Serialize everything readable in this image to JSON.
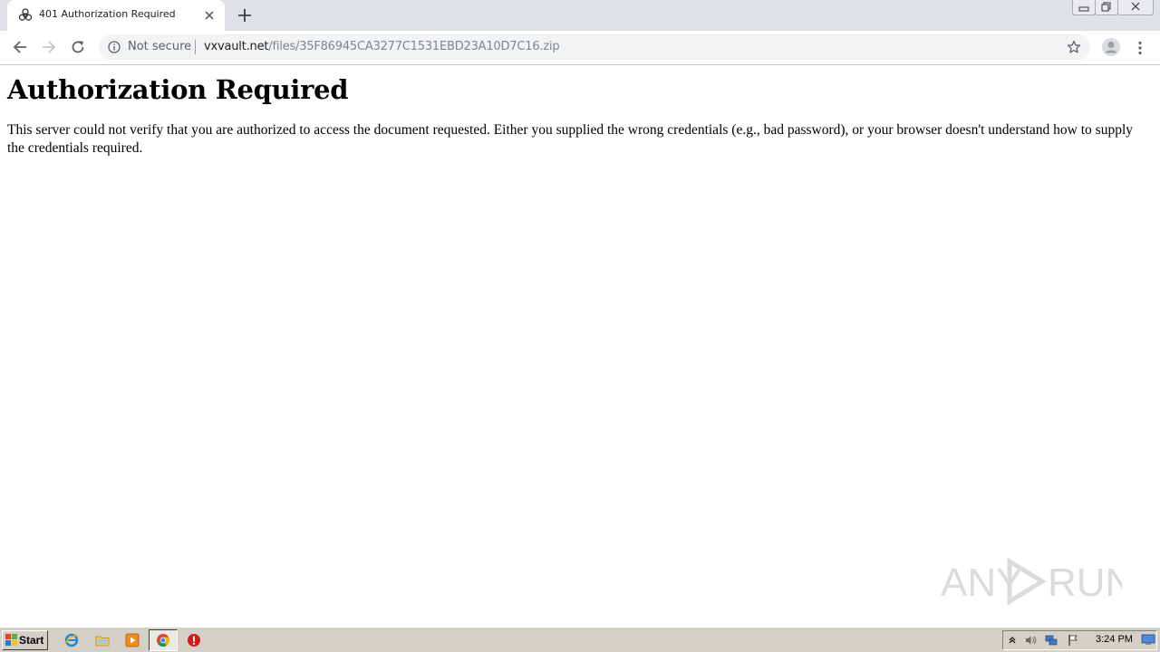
{
  "browser": {
    "tab": {
      "title": "401 Authorization Required",
      "favicon": "biohazard-icon"
    },
    "omnibox": {
      "security_label": "Not secure",
      "url_host": "vxvault.net",
      "url_path": "/files/35F86945CA3277C1531EBD23A10D7C16.zip"
    }
  },
  "page": {
    "heading": "Authorization Required",
    "message": "This server could not verify that you are authorized to access the document requested. Either you supplied the wrong credentials (e.g., bad password), or your browser doesn't understand how to supply the credentials required."
  },
  "watermark": {
    "text_left": "ANY",
    "text_right": "RUN"
  },
  "taskbar": {
    "start_label": "Start",
    "pinned": [
      "internet-explorer-icon",
      "folder-icon",
      "media-player-icon",
      "chrome-icon",
      "stop-icon"
    ],
    "clock": "3:24 PM"
  },
  "colors": {
    "tabstrip": "#dee1e6",
    "omnibox": "#f1f3f4",
    "taskbar": "#d4d0c8"
  }
}
